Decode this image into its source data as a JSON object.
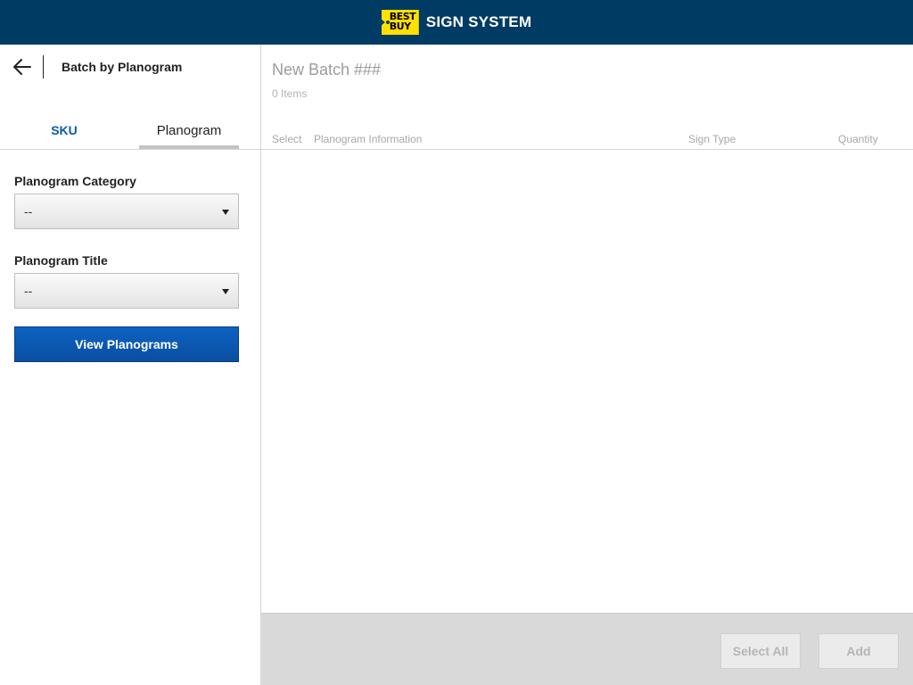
{
  "header": {
    "logo_text_line1": "BEST",
    "logo_text_line2": "BUY",
    "app_title": "SIGN SYSTEM"
  },
  "sidebar": {
    "back_icon": "arrow-left-icon",
    "title": "Batch by Planogram",
    "tabs": [
      {
        "label": "SKU",
        "active": false
      },
      {
        "label": "Planogram",
        "active": true
      }
    ],
    "category": {
      "label": "Planogram Category",
      "selected": "--"
    },
    "title_field": {
      "label": "Planogram Title",
      "selected": "--"
    },
    "view_button": "View Planograms"
  },
  "main": {
    "batch_title": "New Batch ###",
    "item_count": "0 Items",
    "columns": [
      "Select",
      "Planogram Information",
      "Sign Type",
      "Quantity"
    ],
    "rows": []
  },
  "footer": {
    "select_all_label": "Select All",
    "add_label": "Add"
  },
  "colors": {
    "header_bg": "#003b64",
    "brand_yellow": "#ffe000",
    "primary_blue": "#0b5aa8",
    "footer_bg": "#d9d9d9"
  }
}
